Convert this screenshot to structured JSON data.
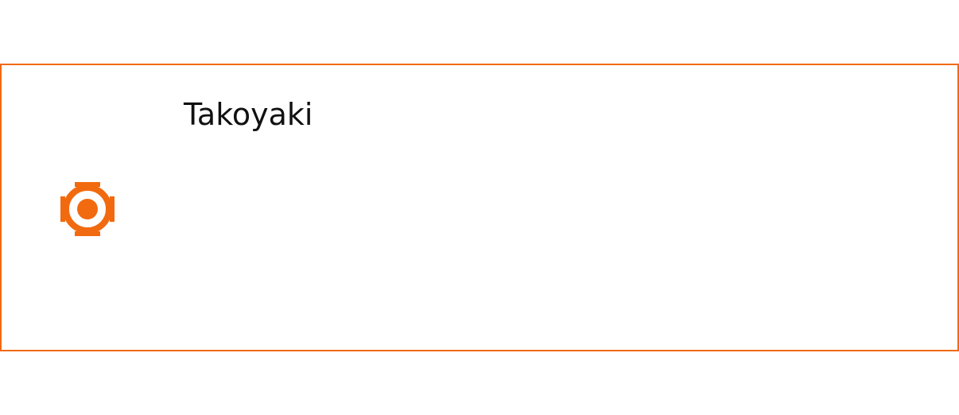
{
  "option": {
    "label": "Takoyaki",
    "selected": true,
    "accent_color": "#f26a0f",
    "icon": "radio-selected-icon"
  }
}
